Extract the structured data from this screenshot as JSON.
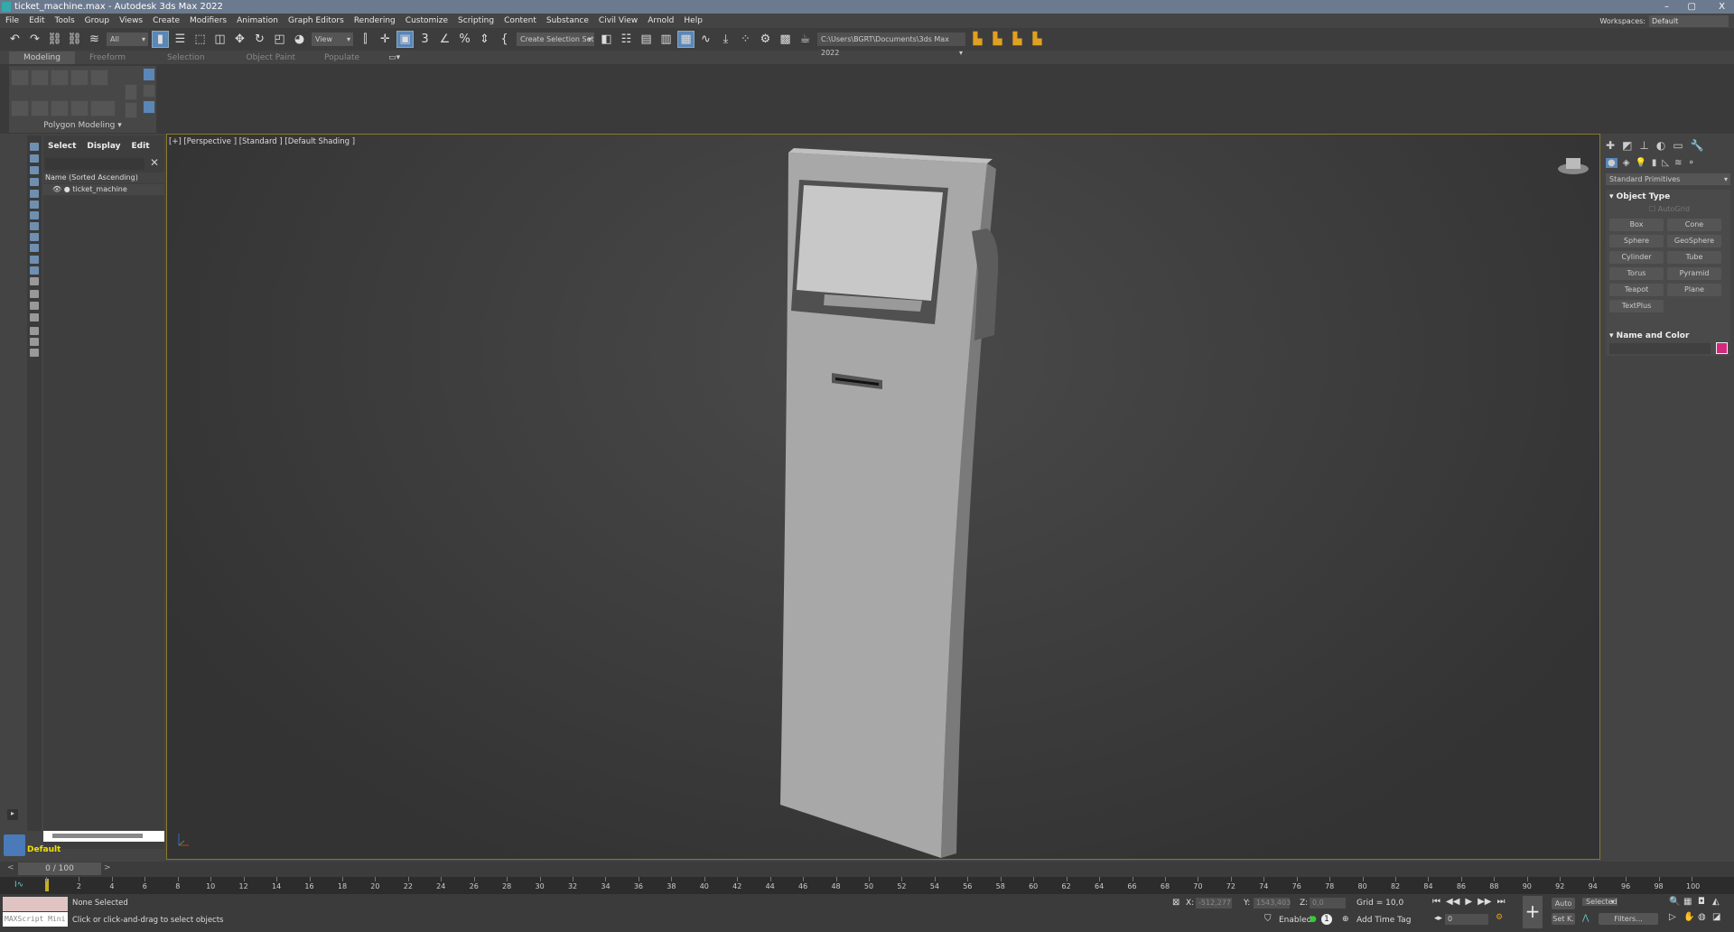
{
  "title": "ticket_machine.max - Autodesk 3ds Max 2022",
  "window_controls": [
    "–",
    "▢",
    "X"
  ],
  "menu": [
    "File",
    "Edit",
    "Tools",
    "Group",
    "Views",
    "Create",
    "Modifiers",
    "Animation",
    "Graph Editors",
    "Rendering",
    "Customize",
    "Scripting",
    "Content",
    "Substance",
    "Civil View",
    "Arnold",
    "Help"
  ],
  "workspaces": {
    "label": "Workspaces:",
    "value": "Default"
  },
  "toolbar": {
    "filter": "All",
    "ref_coord": "View",
    "selection_set": "Create Selection Set",
    "project_path": "C:\\Users\\BGRT\\Documents\\3ds Max 2022",
    "snap_label": "3",
    "percent": "%"
  },
  "ribbon": {
    "tabs": [
      "Modeling",
      "Freeform",
      "Selection",
      "Object Paint",
      "Populate"
    ],
    "active": "Modeling",
    "panel": "Polygon Modeling"
  },
  "explorer": {
    "tabs": [
      "Select",
      "Display",
      "Edit"
    ],
    "column": "Name (Sorted Ascending)",
    "items": [
      "ticket_machine"
    ],
    "layer": "Default"
  },
  "viewport": {
    "label": "[+] [Perspective ] [Standard ] [Default Shading ]"
  },
  "command_panel": {
    "category": "Standard Primitives",
    "rollout1": "Object Type",
    "autogrid": "AutoGrid",
    "buttons": [
      "Box",
      "Cone",
      "Sphere",
      "GeoSphere",
      "Cylinder",
      "Tube",
      "Torus",
      "Pyramid",
      "Teapot",
      "Plane",
      "TextPlus"
    ],
    "rollout2": "Name and Color",
    "color": "#d4287e"
  },
  "timeline": {
    "frame": "0 / 100",
    "ticks": [
      "0",
      "2",
      "4",
      "6",
      "8",
      "10",
      "12",
      "14",
      "16",
      "18",
      "20",
      "22",
      "24",
      "26",
      "28",
      "30",
      "32",
      "34",
      "36",
      "38",
      "40",
      "42",
      "44",
      "46",
      "48",
      "50",
      "52",
      "54",
      "56",
      "58",
      "60",
      "62",
      "64",
      "66",
      "68",
      "70",
      "72",
      "74",
      "76",
      "78",
      "80",
      "82",
      "84",
      "86",
      "88",
      "90",
      "92",
      "94",
      "96",
      "98",
      "100"
    ]
  },
  "status": {
    "selection": "None Selected",
    "prompt": "Click or click-and-drag to select objects",
    "maxscript": "MAXScript Mini",
    "x_label": "X:",
    "x": "-512,277",
    "y_label": "Y:",
    "y": "1543,403",
    "z_label": "Z:",
    "z": "0,0",
    "grid": "Grid = 10,0",
    "enabled": "Enabled:",
    "add_time_tag": "Add Time Tag",
    "auto": "Auto",
    "setk": "Set K.",
    "key_filter": "Selected",
    "filters": "Filters...",
    "frame_field": "0",
    "badge": "1"
  },
  "colors": {
    "accent": "#5a86b8",
    "title_bar": "#6b7a8e",
    "layer_text": "#f0e000",
    "viewport_border": "#8a7a2a"
  }
}
